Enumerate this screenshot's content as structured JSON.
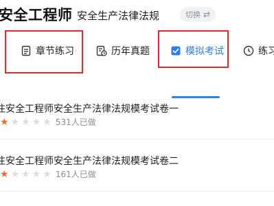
{
  "header": {
    "title": "安全工程师",
    "subject": "安全生产法律法规",
    "switch_label": "切换",
    "switch_icon": "swap-icon"
  },
  "tabs": [
    {
      "label": "章节练习",
      "icon": "document-icon",
      "active": false
    },
    {
      "label": "历年真题",
      "icon": "paper-history-icon",
      "active": false
    },
    {
      "label": "模拟考试",
      "icon": "shield-check-icon",
      "active": true
    },
    {
      "label": "练习",
      "icon": "clock-icon",
      "active": false
    }
  ],
  "exams": [
    {
      "title": "注安全工程师安全生产法律法规模考试卷一",
      "stars": 1,
      "max_stars": 5,
      "count": "531人已做"
    },
    {
      "title": "注安全工程师安全生产法律法规模考试卷二",
      "stars": 1,
      "max_stars": 5,
      "count": "161人已做"
    }
  ],
  "colors": {
    "accent": "#2f7df6",
    "star_on": "#f36b2a",
    "star_off": "#dcdde0",
    "annotation": "#e02a2a"
  }
}
